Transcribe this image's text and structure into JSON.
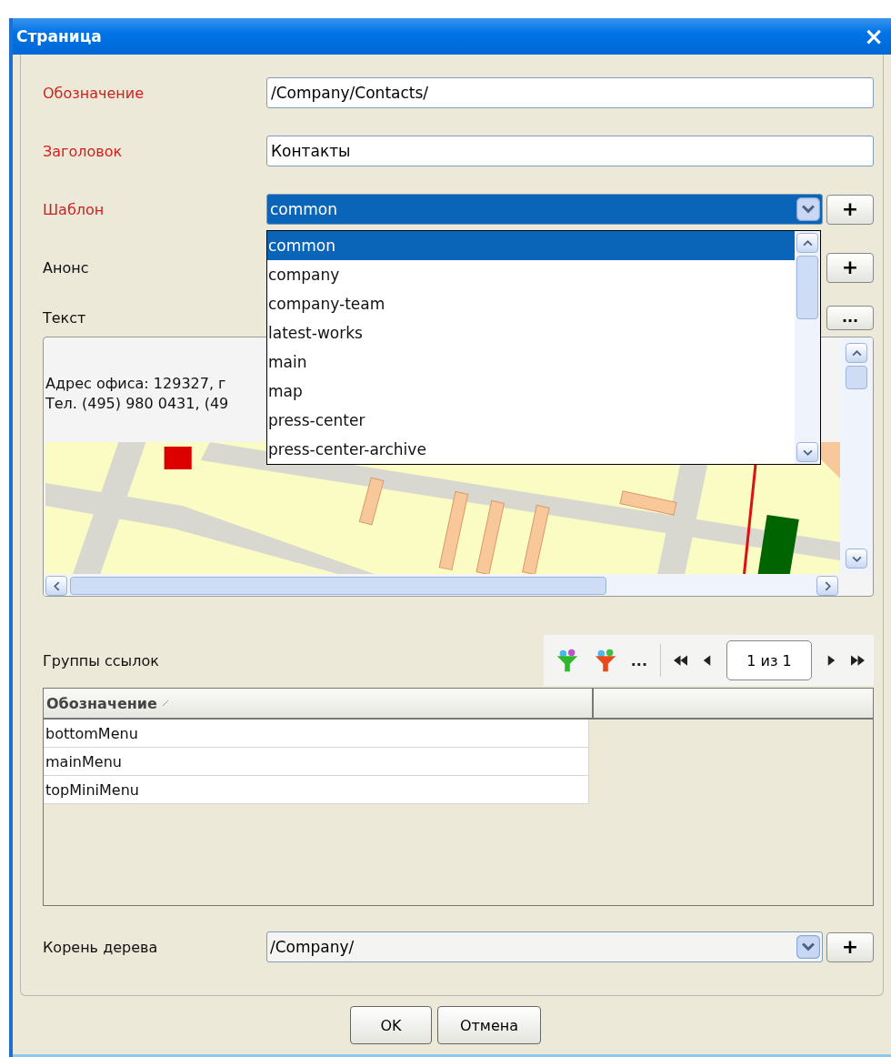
{
  "window": {
    "title": "Страница",
    "close": "×"
  },
  "fields": [
    {
      "kind": "text",
      "label": "Обозначение",
      "required": true,
      "value": "/Company/Contacts/"
    },
    {
      "kind": "text",
      "label": "Заголовок",
      "required": true,
      "value": "Контакты"
    },
    {
      "kind": "select",
      "label": "Шаблон",
      "required": true,
      "value": "common",
      "focused": true,
      "button": "+"
    },
    {
      "kind": "covered",
      "label": "Анонс",
      "required": false,
      "button": "+"
    }
  ],
  "text_editor": {
    "label": "Текст",
    "button": "...",
    "lines": [
      "Адрес офиса: 129327, г",
      "Тел. (495) 980 0431, (49"
    ]
  },
  "dropdown": {
    "options": [
      {
        "label": "common",
        "selected": true
      },
      {
        "label": "company",
        "selected": false
      },
      {
        "label": "company-team",
        "selected": false
      },
      {
        "label": "latest-works",
        "selected": false
      },
      {
        "label": "main",
        "selected": false
      },
      {
        "label": "map",
        "selected": false
      },
      {
        "label": "press-center",
        "selected": false
      },
      {
        "label": "press-center-archive",
        "selected": false
      }
    ]
  },
  "link_groups": {
    "label": "Группы ссылок",
    "more": "...",
    "page": "1 из 1",
    "columns": [
      "Обозначение"
    ],
    "rows": [
      "bottomMenu",
      "mainMenu",
      "topMiniMenu"
    ]
  },
  "tree_root": {
    "label": "Корень дерева",
    "value": "/Company/",
    "button": "+"
  },
  "buttons": [
    "OK",
    "Отмена"
  ]
}
